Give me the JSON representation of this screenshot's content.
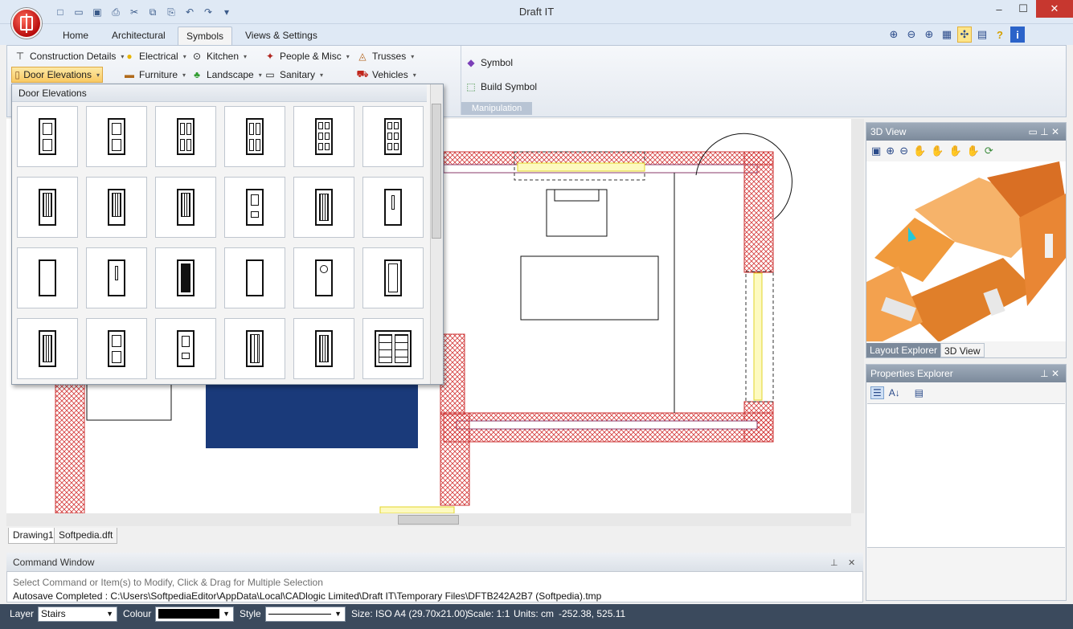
{
  "window": {
    "title": "Draft IT",
    "minimize": "–",
    "maximize": "☐",
    "close": "✕"
  },
  "qat": [
    "□",
    "▭",
    "▣",
    "⎙",
    "✂",
    "⧉",
    "⎘",
    "↶",
    "↷",
    "▾"
  ],
  "tabs": [
    "Home",
    "Architectural",
    "Symbols",
    "Views & Settings"
  ],
  "active_tab": "Symbols",
  "toolbar_icons": [
    "⊕",
    "⊖",
    "⊕",
    "▦",
    "✣",
    "▤",
    "?",
    "i"
  ],
  "ribbon": {
    "construction": "Construction Details",
    "electrical": "Electrical",
    "kitchen": "Kitchen",
    "people": "People & Misc",
    "trusses": "Trusses",
    "door_elevations": "Door Elevations",
    "furniture": "Furniture",
    "landscape": "Landscape",
    "sanitary": "Sanitary",
    "vehicles": "Vehicles",
    "symbol": "Symbol",
    "build_symbol": "Build Symbol",
    "manipulation": "Manipulation"
  },
  "gallery": {
    "header": "Door Elevations"
  },
  "doc_tabs": [
    "Drawing1",
    "Softpedia.dft"
  ],
  "command": {
    "title": "Command Window",
    "hint": "Select Command or Item(s) to Modify, Click & Drag for Multiple Selection",
    "log": "Autosave Completed : C:\\Users\\SoftpediaEditor\\AppData\\Local\\CADlogic Limited\\Draft IT\\Temporary Files\\DFTB242A2B7 (Softpedia).tmp",
    "pin": "⊥",
    "close": "✕"
  },
  "view3d": {
    "title": "3D View",
    "tab_layout": "Layout Explorer",
    "tab_3d": "3D View",
    "controls": "▭ ⊥ ✕"
  },
  "properties": {
    "title": "Properties Explorer",
    "controls": "⊥ ✕"
  },
  "status": {
    "layer_label": "Layer",
    "layer_value": "Stairs",
    "colour_label": "Colour",
    "style_label": "Style",
    "size": "Size: ISO A4 (29.70x21.00)",
    "scale": "Scale: 1:1",
    "units": "Units: cm",
    "coords": "-252.38, 525.11"
  },
  "colors": {
    "titlebar": "#dfe9f5",
    "accent": "#c7372f",
    "wall_hatch": "#d43c3c",
    "window_yellow": "#f2ea3a",
    "view3d_orange": "#f09a3c",
    "status_bar": "#3b4a5d"
  }
}
